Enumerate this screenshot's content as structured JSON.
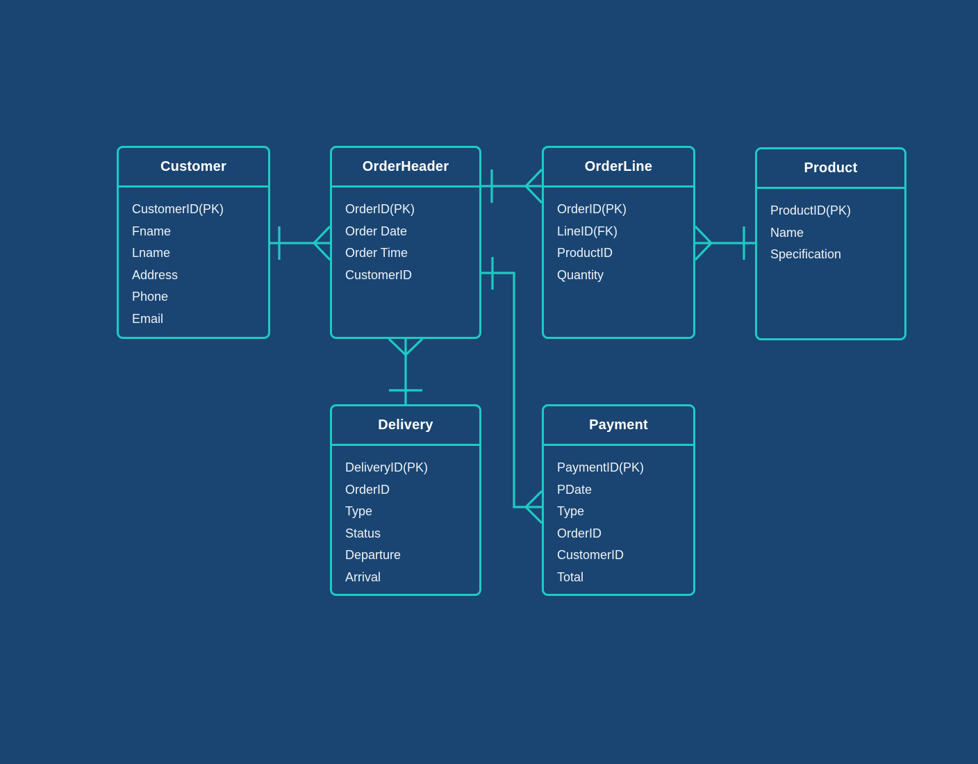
{
  "diagram": {
    "type": "entity-relationship-diagram",
    "notation": "crow's foot",
    "background_color": "#1a4572",
    "line_color": "#1ecbc4",
    "text_color": "#ffffff"
  },
  "entities": [
    {
      "id": "customer",
      "title": "Customer",
      "attributes": [
        "CustomerID(PK)",
        "Fname",
        "Lname",
        "Address",
        "Phone",
        "Email"
      ]
    },
    {
      "id": "orderheader",
      "title": "OrderHeader",
      "attributes": [
        "OrderID(PK)",
        "Order Date",
        "Order Time",
        "CustomerID"
      ]
    },
    {
      "id": "orderline",
      "title": "OrderLine",
      "attributes": [
        "OrderID(PK)",
        "LineID(FK)",
        "ProductID",
        "Quantity"
      ]
    },
    {
      "id": "product",
      "title": "Product",
      "attributes": [
        "ProductID(PK)",
        "Name",
        "Specification"
      ]
    },
    {
      "id": "delivery",
      "title": "Delivery",
      "attributes": [
        "DeliveryID(PK)",
        "OrderID",
        "Type",
        "Status",
        "Departure",
        "Arrival"
      ]
    },
    {
      "id": "payment",
      "title": "Payment",
      "attributes": [
        "PaymentID(PK)",
        "PDate",
        "Type",
        "OrderID",
        "CustomerID",
        "Total"
      ]
    }
  ],
  "relationships": [
    {
      "id": "customer-orderheader",
      "from": "Customer",
      "to": "OrderHeader",
      "from_cardinality": "one",
      "to_cardinality": "many"
    },
    {
      "id": "orderheader-orderline",
      "from": "OrderHeader",
      "to": "OrderLine",
      "from_cardinality": "one",
      "to_cardinality": "many"
    },
    {
      "id": "orderline-product",
      "from": "OrderLine",
      "to": "Product",
      "from_cardinality": "many",
      "to_cardinality": "one"
    },
    {
      "id": "orderheader-delivery",
      "from": "OrderHeader",
      "to": "Delivery",
      "from_cardinality": "many",
      "to_cardinality": "one"
    },
    {
      "id": "orderheader-payment",
      "from": "OrderHeader",
      "to": "Payment",
      "from_cardinality": "one",
      "to_cardinality": "many"
    }
  ]
}
